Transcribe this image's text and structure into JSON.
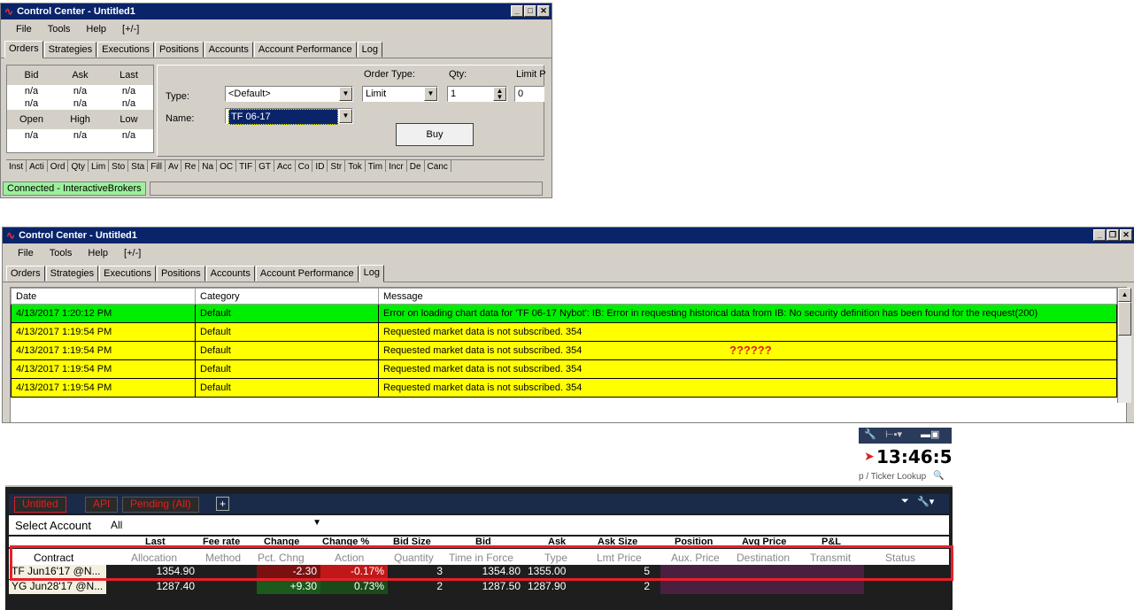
{
  "win1": {
    "title": "Control Center - Untitled1",
    "menu": [
      "File",
      "Tools",
      "Help",
      "[+/-]"
    ],
    "tabs": [
      "Orders",
      "Strategies",
      "Executions",
      "Positions",
      "Accounts",
      "Account Performance",
      "Log"
    ],
    "quote": {
      "hdr1": [
        "Bid",
        "Ask",
        "Last"
      ],
      "row1": [
        "n/a",
        "n/a",
        "n/a"
      ],
      "row2": [
        "n/a",
        "n/a",
        "n/a"
      ],
      "hdr2": [
        "Open",
        "High",
        "Low"
      ],
      "row3": [
        "n/a",
        "n/a",
        "n/a"
      ]
    },
    "order": {
      "order_type_label": "Order Type:",
      "qty_label": "Qty:",
      "limit_label": "Limit P",
      "type_label": "Type:",
      "type_value": "<Default>",
      "order_type_value": "Limit",
      "qty_value": "1",
      "limit_value": "0",
      "name_label": "Name:",
      "name_value": "TF 06-17",
      "buy_label": "Buy"
    },
    "columns": [
      "Inst",
      "Acti",
      "Ord",
      "Qty",
      "Lim",
      "Sto",
      "Sta",
      "Fill",
      "Av",
      "Re",
      "Na",
      "OC",
      "TIF",
      "GT",
      "Acc",
      "Co",
      "ID",
      "Str",
      "Tok",
      "Tim",
      "Incr",
      "De",
      "Canc"
    ],
    "status": "Connected - InteractiveBrokers"
  },
  "win2": {
    "title": "Control Center - Untitled1",
    "menu": [
      "File",
      "Tools",
      "Help",
      "[+/-]"
    ],
    "tabs": [
      "Orders",
      "Strategies",
      "Executions",
      "Positions",
      "Accounts",
      "Account Performance",
      "Log"
    ],
    "log_headers": [
      "Date",
      "Category",
      "Message"
    ],
    "log_rows": [
      {
        "date": "4/13/2017 1:20:12 PM",
        "category": "Default",
        "message": "Error on loading chart data for 'TF 06-17 Nybot': IB: Error in requesting historical data from IB: No security definition has been found for the request(200)",
        "color": "#00ee00"
      },
      {
        "date": "4/13/2017 1:19:54 PM",
        "category": "Default",
        "message": "Requested market data is not subscribed. 354",
        "color": "#ffff00"
      },
      {
        "date": "4/13/2017 1:19:54 PM",
        "category": "Default",
        "message": "Requested market data is not subscribed. 354",
        "color": "#ffff00"
      },
      {
        "date": "4/13/2017 1:19:54 PM",
        "category": "Default",
        "message": "Requested market data is not subscribed. 354",
        "color": "#ffff00"
      },
      {
        "date": "4/13/2017 1:19:54 PM",
        "category": "Default",
        "message": "Requested market data is not subscribed. 354",
        "color": "#ffff00"
      }
    ],
    "annotation": "??????"
  },
  "tws": {
    "clock": "13:46:5",
    "ticker_lookup": "p / Ticker Lookup",
    "tabs": [
      "Untitled",
      "API",
      "Pending (All)",
      "+"
    ],
    "select_account_label": "Select Account",
    "select_account_value": "All",
    "top_headers": [
      "Last",
      "Fee rate",
      "Change",
      "Change %",
      "Bid Size",
      "Bid",
      "Ask",
      "Ask Size",
      "Position",
      "Avg Price",
      "P&L"
    ],
    "sub_headers": [
      "Contract",
      "Allocation",
      "Method",
      "Pct. Chng",
      "Action",
      "Quantity",
      "Time in Force",
      "Type",
      "Lmt Price",
      "Aux. Price",
      "Destination",
      "Transmit",
      "Status"
    ],
    "rows": [
      [
        "TF Jun16'17 @N...",
        "1354.90",
        "",
        "-2.30",
        "-0.17%",
        "3",
        "1354.80",
        "1355.00",
        "5",
        "",
        "",
        "",
        ""
      ],
      [
        "YG Jun28'17 @N...",
        "1287.40",
        "",
        "+9.30",
        "0.73%",
        "2",
        "1287.50",
        "1287.90",
        "2",
        "",
        "",
        "",
        ""
      ]
    ],
    "highlight_color": "#e8202a"
  }
}
